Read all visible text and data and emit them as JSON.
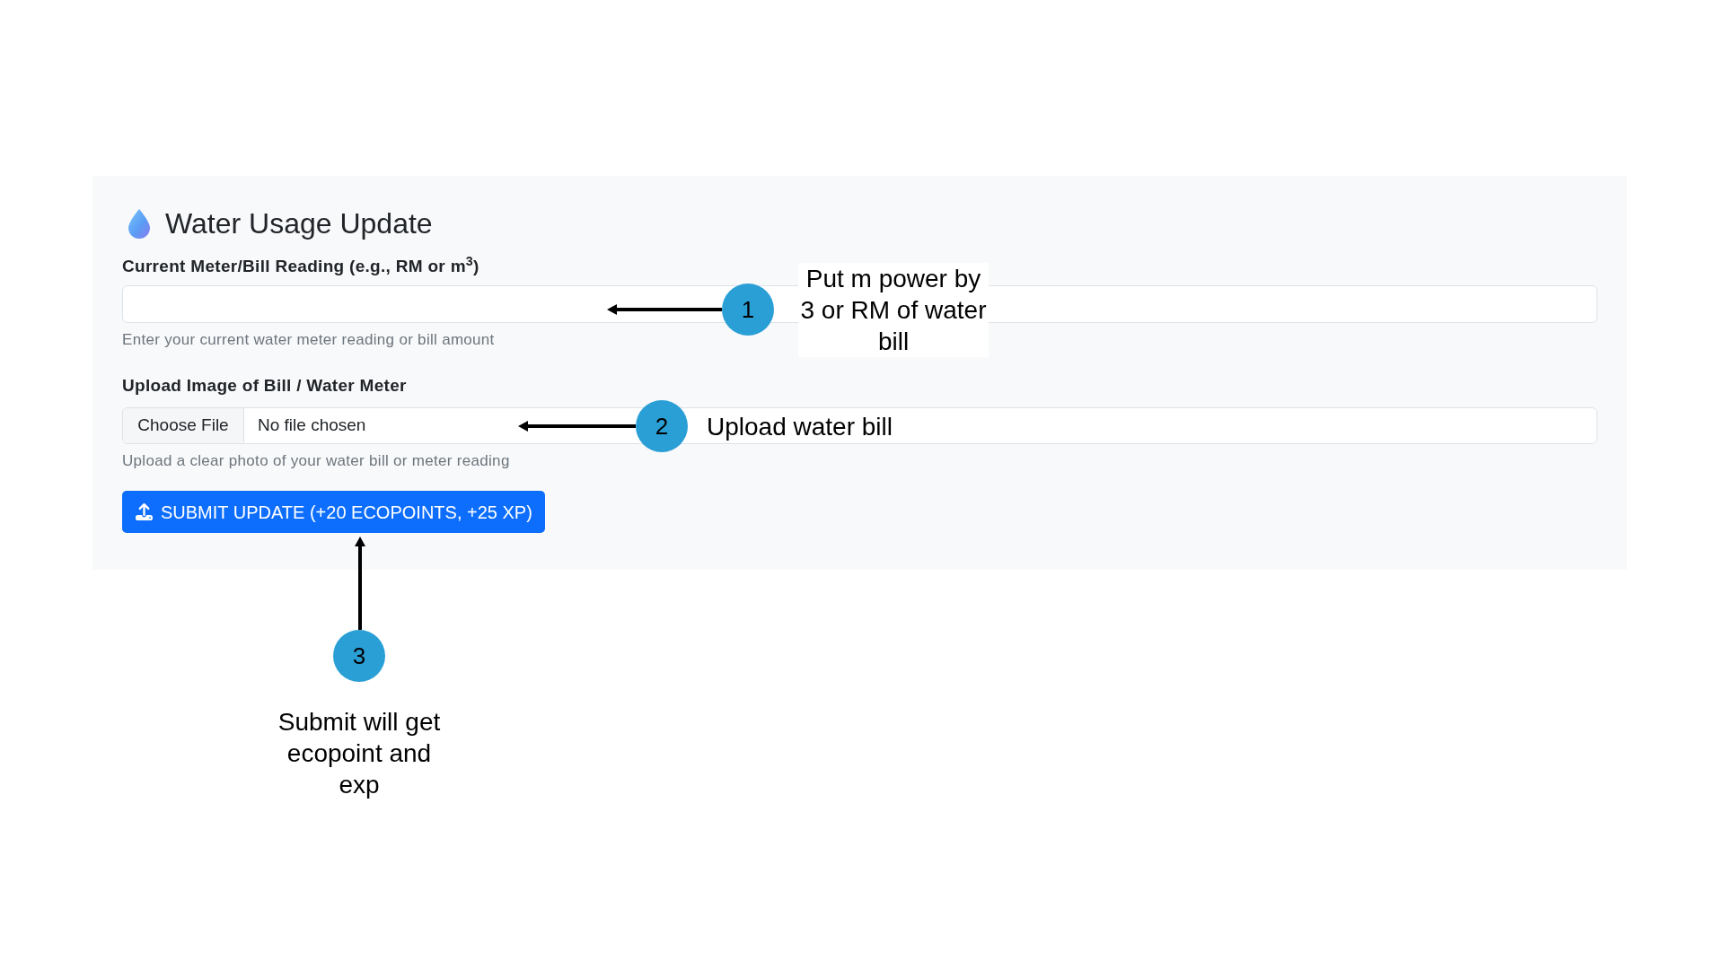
{
  "form": {
    "title": "Water Usage Update",
    "fields": [
      {
        "kind": "text",
        "label": "Current Meter/Bill Reading (e.g., RM or m$^{3}$)",
        "help": "Enter your current water meter reading or bill amount"
      },
      {
        "kind": "file",
        "label": "Upload Image of Bill / Water Meter",
        "button": "Choose File",
        "value": "No file chosen",
        "help": "Upload a clear photo of your water bill or meter reading"
      }
    ],
    "submit_button": "SUBMIT UPDATE (+20 ECOPOINTS, +25 XP)"
  },
  "annotations": [
    {
      "number": "1",
      "text": "Put m power by 3 or RM of water bill"
    },
    {
      "number": "2",
      "text": "Upload water bill"
    },
    {
      "number": "3",
      "text": "Submit will get ecopoint and exp"
    }
  ]
}
